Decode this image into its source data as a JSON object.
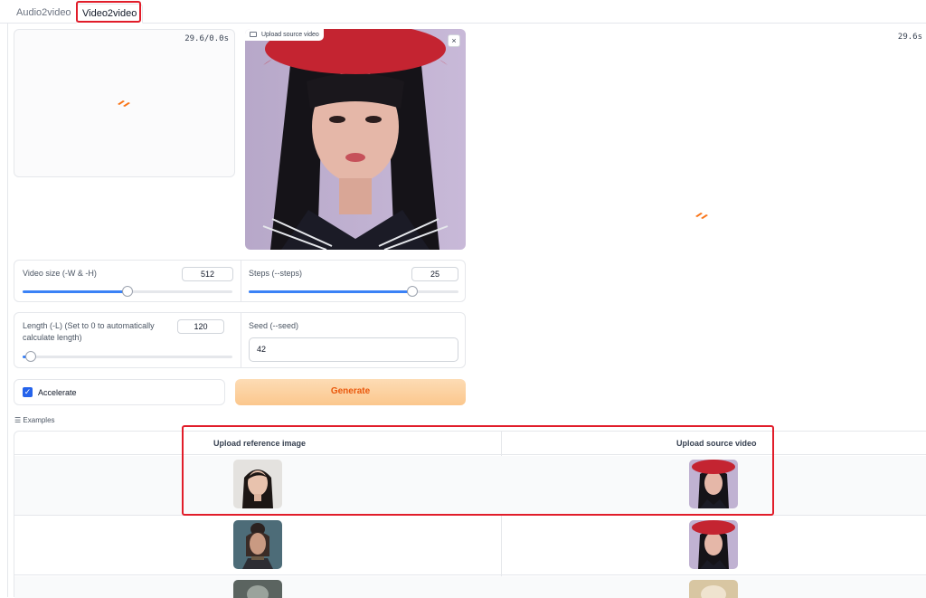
{
  "tabs": [
    {
      "label": "Audio2video",
      "active": false
    },
    {
      "label": "Video2video",
      "active": true
    }
  ],
  "output_video_left": {
    "timer": "29.6/0.0s"
  },
  "source_video": {
    "label": "Upload source video",
    "close": "×"
  },
  "output_video_right": {
    "timer": "29.6s"
  },
  "controls": {
    "video_size": {
      "label": "Video size (-W & -H)",
      "value": "512",
      "fraction": 0.5
    },
    "steps": {
      "label": "Steps (--steps)",
      "value": "25",
      "fraction": 0.78
    },
    "length": {
      "label": "Length (-L) (Set to 0 to automatically calculate length)",
      "value": "120",
      "fraction": 0.03
    },
    "seed": {
      "label": "Seed (--seed)",
      "value": "42"
    }
  },
  "accelerate": {
    "label": "Accelerate",
    "checked": true
  },
  "generate_button": {
    "label": "Generate"
  },
  "examples": {
    "title": "Examples",
    "headers": [
      "Upload reference image",
      "Upload source video"
    ]
  },
  "colors": {
    "accent": "#3b82f6",
    "highlight": "#e11d2a",
    "generate": "#fbc78d"
  }
}
